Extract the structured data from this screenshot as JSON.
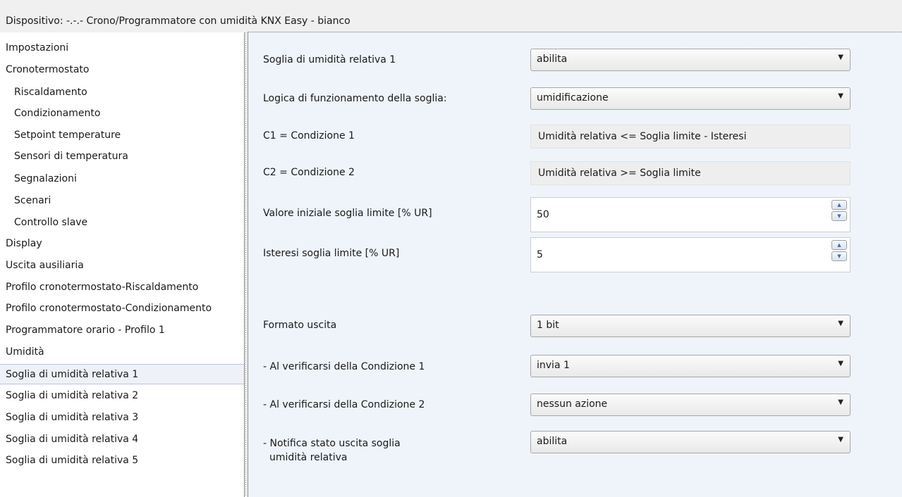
{
  "window": {
    "title": "Dispositivo: -.-.-  Crono/Programmatore con umidità KNX Easy - bianco"
  },
  "sidebar": {
    "items": [
      {
        "label": "Impostazioni"
      },
      {
        "label": "Cronotermostato"
      },
      {
        "label": "Riscaldamento"
      },
      {
        "label": "Condizionamento"
      },
      {
        "label": "Setpoint temperature"
      },
      {
        "label": "Sensori di temperatura"
      },
      {
        "label": "Segnalazioni"
      },
      {
        "label": "Scenari"
      },
      {
        "label": "Controllo slave"
      },
      {
        "label": "Display"
      },
      {
        "label": "Uscita ausiliaria"
      },
      {
        "label": "Profilo cronotermostato-Riscaldamento"
      },
      {
        "label": "Profilo cronotermostato-Condizionamento"
      },
      {
        "label": "Programmatore orario - Profilo 1"
      },
      {
        "label": "Umidità"
      },
      {
        "label": "Soglia di umidità relativa 1"
      },
      {
        "label": "Soglia di umidità relativa 2"
      },
      {
        "label": "Soglia di umidità relativa 3"
      },
      {
        "label": "Soglia di umidità relativa 4"
      },
      {
        "label": "Soglia di umidità relativa 5"
      }
    ],
    "selected_index": 15
  },
  "params": {
    "soglia": {
      "label": "Soglia di umidità relativa 1",
      "value": "abilita"
    },
    "logica": {
      "label": "Logica di funzionamento della soglia:",
      "value": "umidificazione"
    },
    "c1": {
      "label": "C1 = Condizione 1",
      "value": "Umidità relativa <= Soglia limite - Isteresi"
    },
    "c2": {
      "label": "C2 = Condizione 2",
      "value": "Umidità relativa >= Soglia limite"
    },
    "valore_iniziale": {
      "label": "Valore iniziale soglia limite [% UR]",
      "value": "50"
    },
    "isteresi": {
      "label": "Isteresi soglia limite [% UR]",
      "value": "5"
    },
    "formato": {
      "label": "Formato uscita",
      "value": "1 bit"
    },
    "cond1": {
      "label": "- Al verificarsi della Condizione 1",
      "value": "invia 1"
    },
    "cond2": {
      "label": "- Al verificarsi della Condizione 2",
      "value": "nessun azione"
    },
    "notifica": {
      "label_line1": "- Notifica stato uscita soglia",
      "label_line2": "  umidità relativa",
      "value": "abilita"
    }
  },
  "icons": {
    "combo_arrow": "▼",
    "spin_up": "▲",
    "spin_down": "▼"
  },
  "colors": {
    "content_bg": "#eef4fa",
    "selection_bg": "#eef2f8",
    "spin_arrow": "#3b6fb0"
  }
}
